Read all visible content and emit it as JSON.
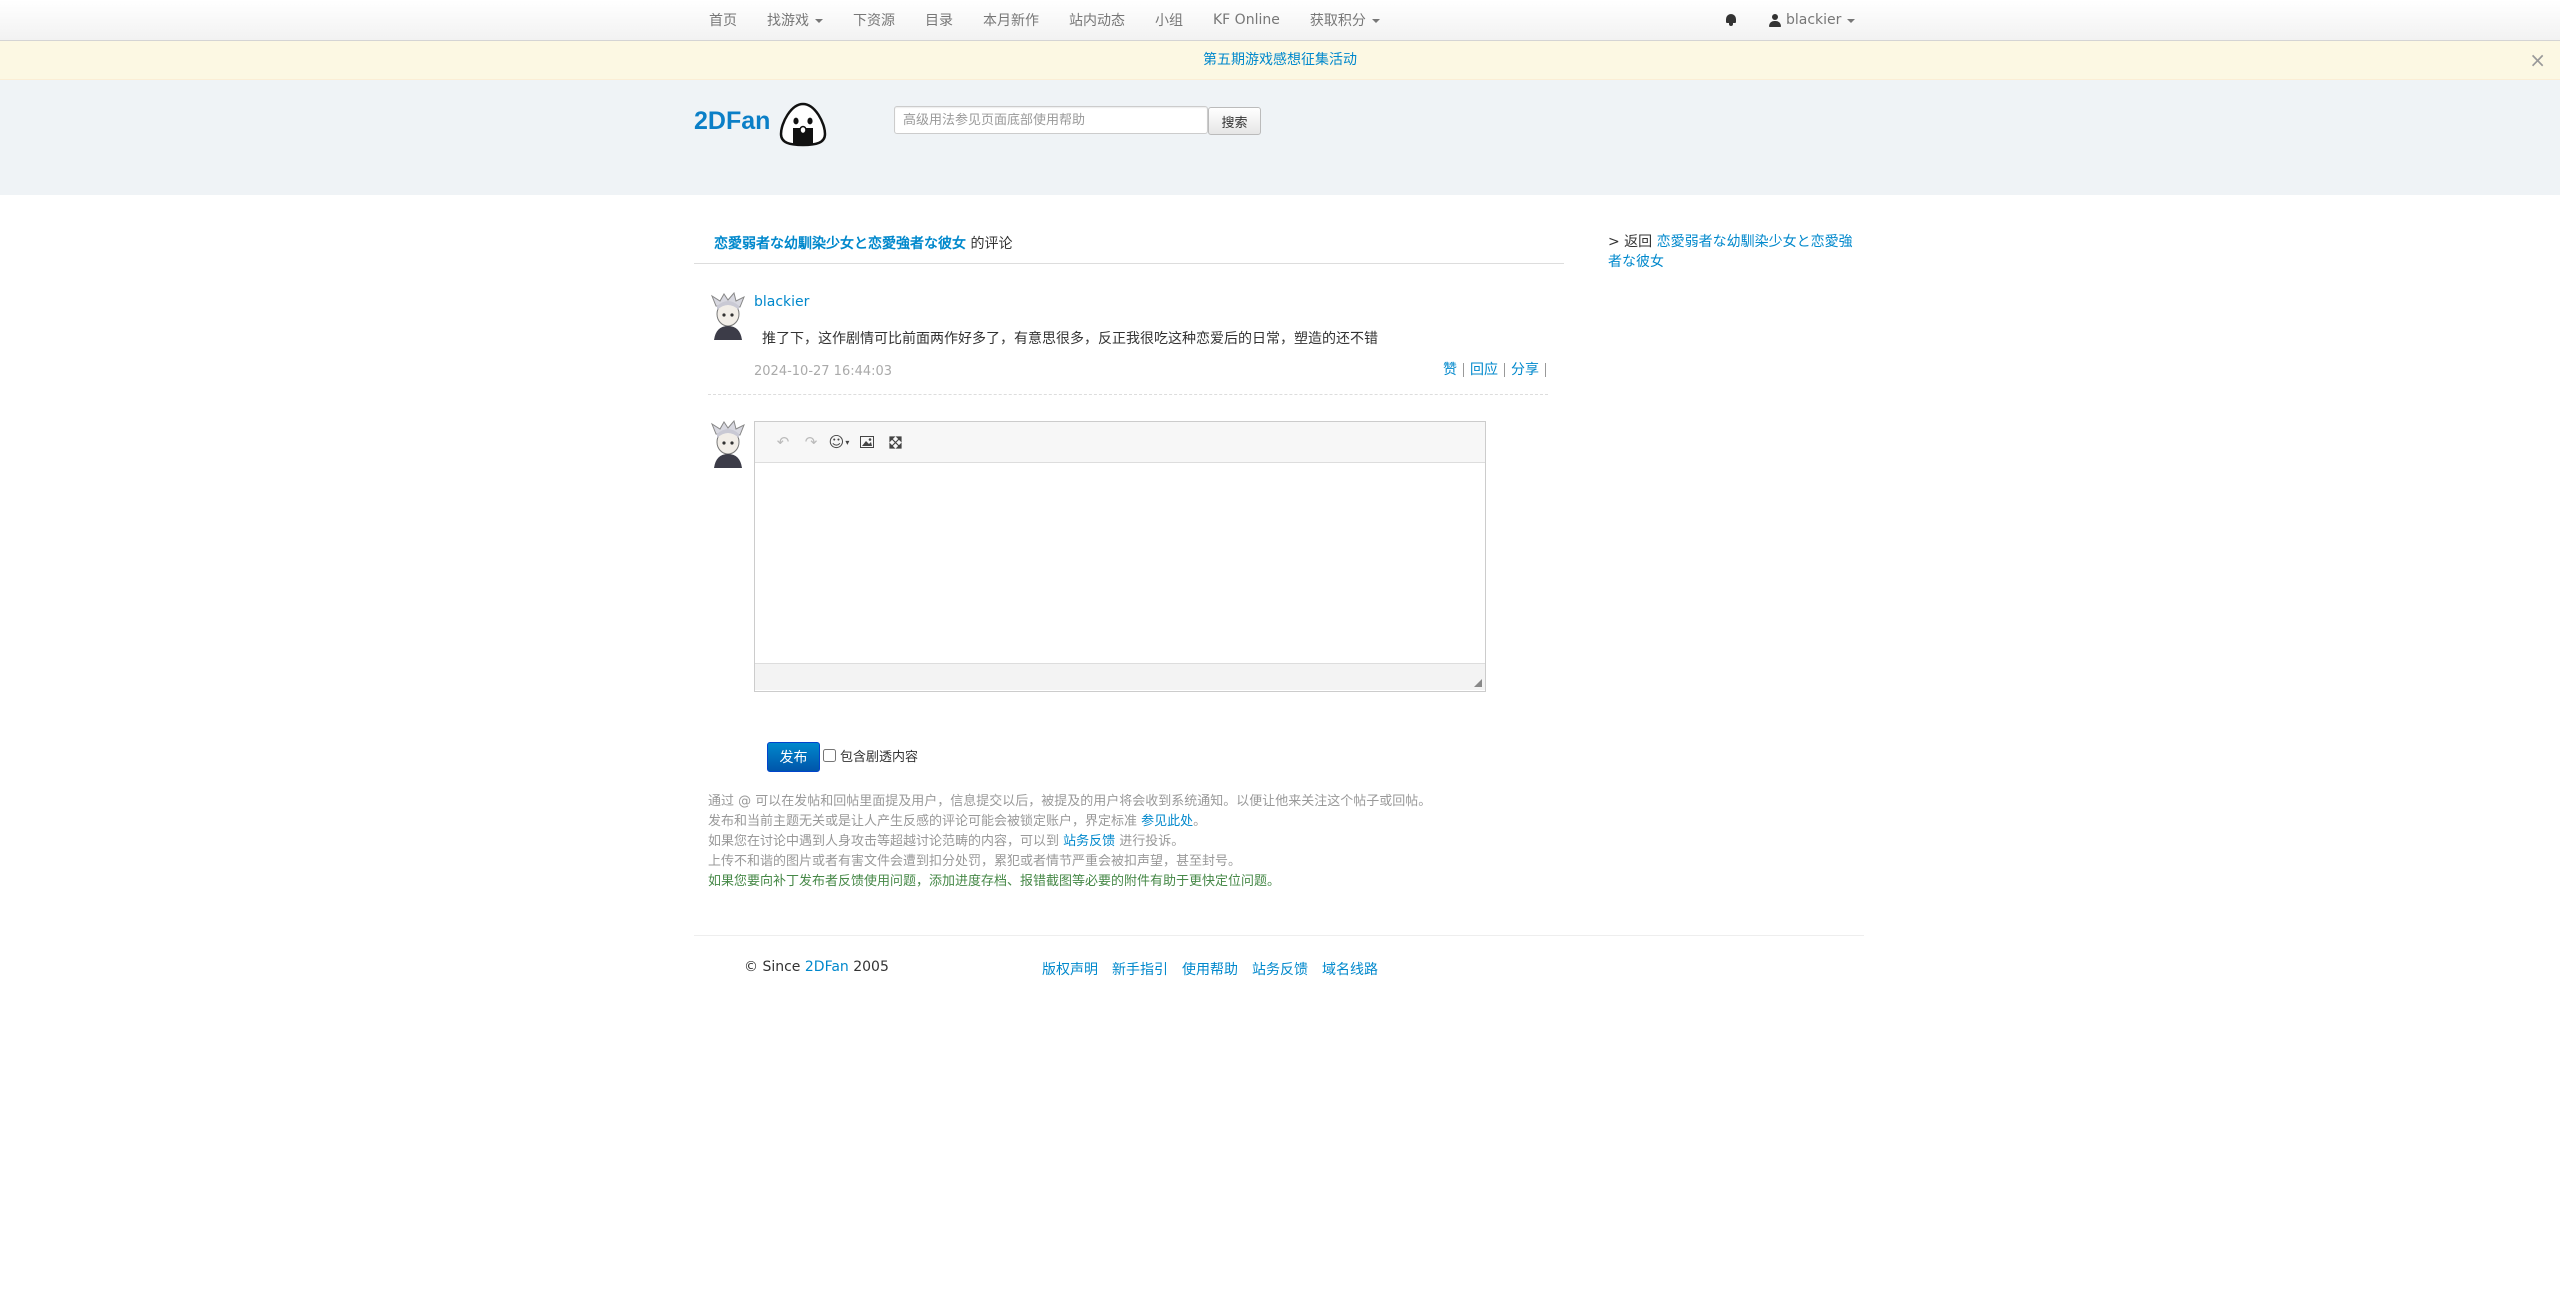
{
  "navbar": {
    "items": [
      {
        "label": "首页",
        "dropdown": false
      },
      {
        "label": "找游戏",
        "dropdown": true
      },
      {
        "label": "下资源",
        "dropdown": false
      },
      {
        "label": "目录",
        "dropdown": false
      },
      {
        "label": "本月新作",
        "dropdown": false
      },
      {
        "label": "站内动态",
        "dropdown": false
      },
      {
        "label": "小组",
        "dropdown": false
      },
      {
        "label": "KF Online",
        "dropdown": false
      },
      {
        "label": "获取积分",
        "dropdown": true
      }
    ],
    "username": "blackier",
    "icons": {
      "notifications": "bell-icon",
      "user": "user-icon"
    }
  },
  "notice": {
    "text": "第五期游戏感想征集活动",
    "close": "×"
  },
  "header": {
    "logo": "2DFan",
    "search_placeholder": "高级用法参见页面底部使用帮助",
    "search_button": "搜索"
  },
  "page": {
    "game_title": "恋愛弱者な幼馴染少女と恋愛強者な彼女",
    "title_suffix": "的评论"
  },
  "comment": {
    "user": "blackier",
    "text": "推了下，这作剧情可比前面两作好多了，有意思很多，反正我很吃这种恋爱后的日常，塑造的还不错",
    "time": "2024-10-27 16:44:03",
    "actions": [
      "赞",
      "回应",
      "分享"
    ]
  },
  "editor": {
    "toolbar_icons": [
      "undo-icon",
      "redo-icon",
      "emoticon-icon",
      "image-icon",
      "fullscreen-icon"
    ]
  },
  "form": {
    "publish_button": "发布",
    "spoiler_label": "包含剧透内容",
    "spoiler_checked": false
  },
  "rules": {
    "line1": "通过 @ 可以在发帖和回帖里面提及用户，信息提交以后，被提及的用户将会收到系统通知。以便让他来关注这个帖子或回帖。",
    "line2_text": "发布和当前主题无关或是让人产生反感的评论可能会被锁定账户，界定标准 ",
    "line2_link": "参见此处",
    "line2_end": "。",
    "line3_text": "如果您在讨论中遇到人身攻击等超越讨论范畴的内容，可以到 ",
    "line3_link": "站务反馈",
    "line3_end": " 进行投诉。",
    "line4": "上传不和谐的图片或者有害文件会遭到扣分处罚，累犯或者情节严重会被扣声望，甚至封号。",
    "line5": "如果您要向补丁发布者反馈使用问题，添加进度存档、报错截图等必要的附件有助于更快定位问题。"
  },
  "sidebar": {
    "back_prefix": "> 返回 ",
    "back_link": "恋愛弱者な幼馴染少女と恋愛強者な彼女"
  },
  "footer": {
    "copyright_prefix": "© Since ",
    "copyright_brand": "2DFan",
    "copyright_year": " 2005",
    "links": [
      "版权声明",
      "新手指引",
      "使用帮助",
      "站务反馈",
      "域名线路"
    ]
  }
}
